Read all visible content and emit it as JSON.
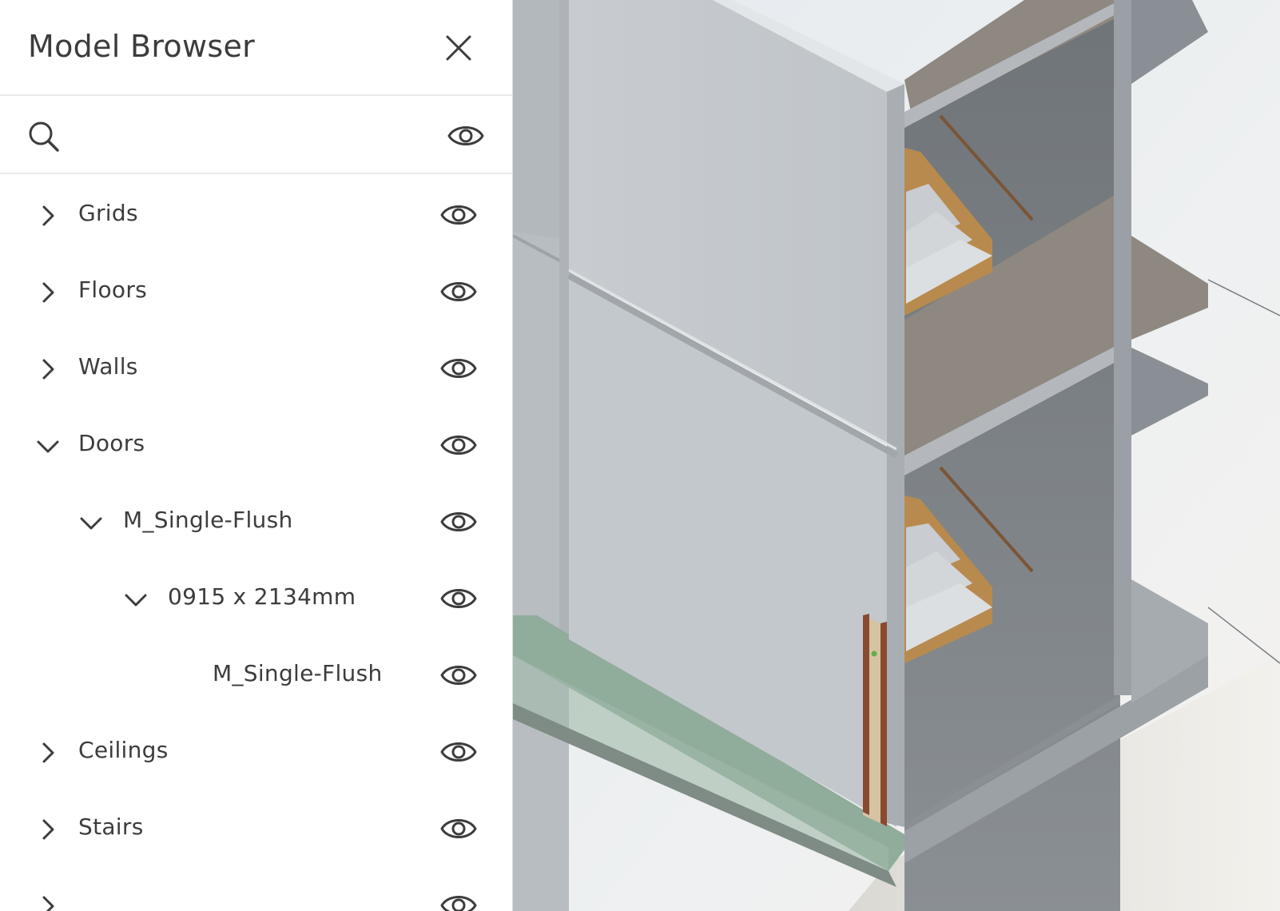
{
  "panel": {
    "title": "Model Browser",
    "close_icon": "close-icon",
    "search": {
      "value": "",
      "placeholder": "",
      "icon": "search-icon",
      "visibility_icon": "eye-icon"
    }
  },
  "tree": [
    {
      "label": "Grids",
      "level": 0,
      "state": "collapsed"
    },
    {
      "label": "Floors",
      "level": 0,
      "state": "collapsed"
    },
    {
      "label": "Walls",
      "level": 0,
      "state": "collapsed"
    },
    {
      "label": "Doors",
      "level": 0,
      "state": "expanded"
    },
    {
      "label": "M_Single-Flush",
      "level": 1,
      "state": "expanded"
    },
    {
      "label": "0915 x 2134mm",
      "level": 2,
      "state": "expanded"
    },
    {
      "label": "M_Single-Flush",
      "level": 3,
      "state": "leaf"
    },
    {
      "label": "Ceilings",
      "level": 0,
      "state": "collapsed"
    },
    {
      "label": "Stairs",
      "level": 0,
      "state": "collapsed"
    },
    {
      "label": "",
      "level": 0,
      "state": "collapsed"
    }
  ],
  "colors": {
    "panel_bg": "#ffffff",
    "text": "#3c3c3c",
    "wall": "#c4c9ce",
    "floor_slab": "#8f8880",
    "stair_wood": "#b98a4e",
    "ground_green": "#8fae9b",
    "door_frame": "#8a4a2e"
  }
}
